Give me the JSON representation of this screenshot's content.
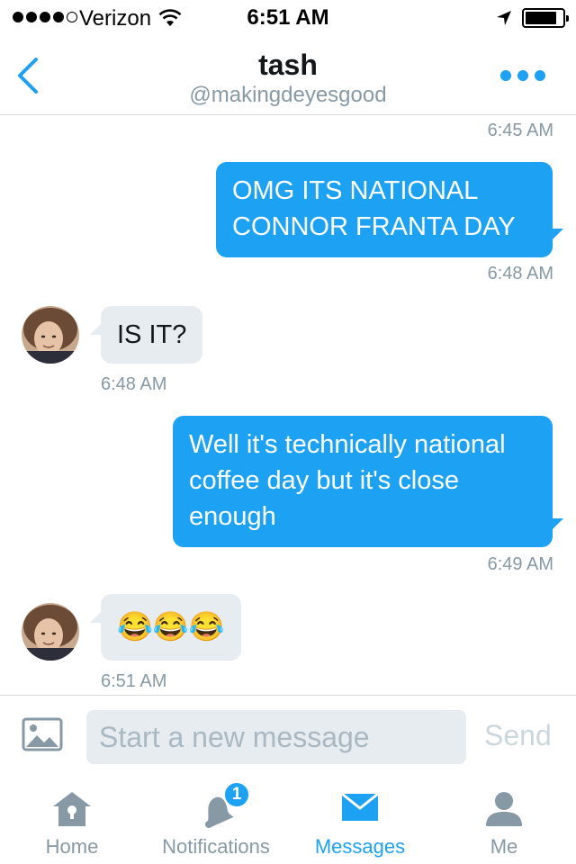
{
  "status_bar": {
    "carrier": "Verizon",
    "time": "6:51 AM",
    "signal_bars": 4,
    "battery_level": 0.85
  },
  "header": {
    "title": "tash",
    "handle": "@makingdeyesgood"
  },
  "messages": [
    {
      "timestamp": "6:45 AM"
    },
    {
      "direction": "outgoing",
      "text": "OMG ITS NATIONAL CONNOR FRANTA DAY",
      "timestamp": "6:48 AM"
    },
    {
      "direction": "incoming",
      "text": "IS IT?",
      "timestamp": "6:48 AM"
    },
    {
      "direction": "outgoing",
      "text": "Well it's technically national coffee day but it's close enough",
      "timestamp": "6:49 AM"
    },
    {
      "direction": "incoming",
      "text": "😂😂😂",
      "timestamp": "6:51 AM"
    }
  ],
  "compose": {
    "placeholder": "Start a new message",
    "send_label": "Send"
  },
  "tabs": [
    {
      "label": "Home",
      "icon": "home-icon"
    },
    {
      "label": "Notifications",
      "icon": "bell-icon",
      "badge": "1"
    },
    {
      "label": "Messages",
      "icon": "envelope-icon",
      "active": true
    },
    {
      "label": "Me",
      "icon": "person-icon"
    }
  ],
  "colors": {
    "accent": "#1da1f2",
    "incoming_bubble": "#e6ecf0",
    "muted_text": "#8899a6"
  }
}
